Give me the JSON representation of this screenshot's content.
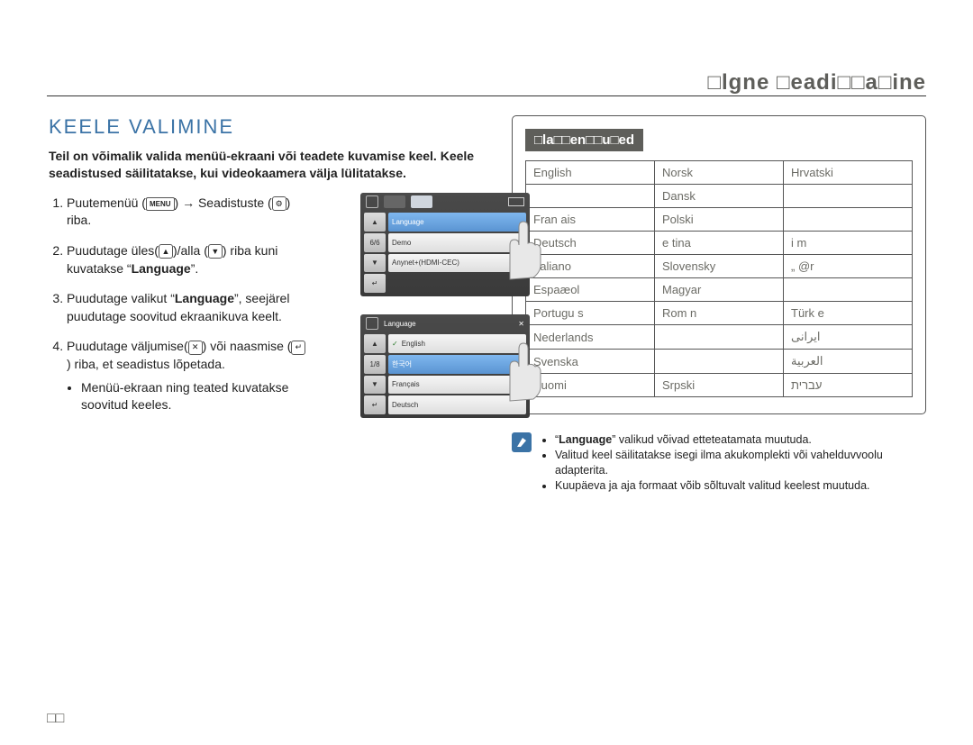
{
  "running_head": "□lgne □eadi□□a□ine",
  "section_title": "KEELE VALIMINE",
  "intro1": "Teil on võimalik valida menüü-ekraani või teadete kuvamise keel.",
  "intro2": "Keele seadistused säilitatakse, kui videokaamera välja lülitatakse.",
  "steps": {
    "s1a": "Puutemenüü (",
    "s1_menu": "MENU",
    "s1b": ") → Seadistuste (",
    "s1_gear": "⚙",
    "s1c": ") riba.",
    "s2a": "Puudutage üles(",
    "s2b": ")/alla (",
    "s2c": ") riba kuni kuvatakse “",
    "s2_lang": "Language",
    "s2d": "”.",
    "s3a": "Puudutage valikut “",
    "s3_lang": "Language",
    "s3b": "”, seejärel puudutage soovitud ekraanikuva keelt.",
    "s4a": "Puudutage väljumise(",
    "s4b": ") või naasmise (",
    "s4c": ") riba, et seadistus lõpetada.",
    "s4_bullet": "Menüü-ekraan ning teated kuvatakse soovitud keeles."
  },
  "screen1": {
    "title": "",
    "row1": "Language",
    "row2": "Demo",
    "row3": "Anynet+(HDMI-CEC)",
    "pager": "6/6"
  },
  "screen2": {
    "title": "Language",
    "row1": "English",
    "row2": "한국어",
    "row3": "Français",
    "row4": "Deutsch",
    "pager": "1/8"
  },
  "box_title": "□la□□en□□u□ed",
  "languages": [
    [
      "English",
      "Norsk",
      "Hrvatski"
    ],
    [
      "",
      "Dansk",
      ""
    ],
    [
      "Fran ais",
      "Polski",
      ""
    ],
    [
      "Deutsch",
      "e tina",
      "i m"
    ],
    [
      "Italiano",
      "Slovensky",
      "„ @r"
    ],
    [
      "Espaæol",
      "Magyar",
      ""
    ],
    [
      "Portugu s",
      "Rom n",
      "Türk e"
    ],
    [
      "Nederlands",
      "",
      "ایرانی"
    ],
    [
      "Svenska",
      "",
      "العربية"
    ],
    [
      "Suomi",
      "Srpski",
      "עברית"
    ]
  ],
  "notes": {
    "n1a": "“",
    "n1_lang": "Language",
    "n1b": "” valikud võivad etteteatamata muutuda.",
    "n2": "Valitud keel säilitatakse isegi ilma akukomplekti või vahelduvvoolu adapterita.",
    "n3": "Kuupäeva ja aja formaat võib sõltuvalt valitud keelest muutuda."
  },
  "page_num": "□□"
}
